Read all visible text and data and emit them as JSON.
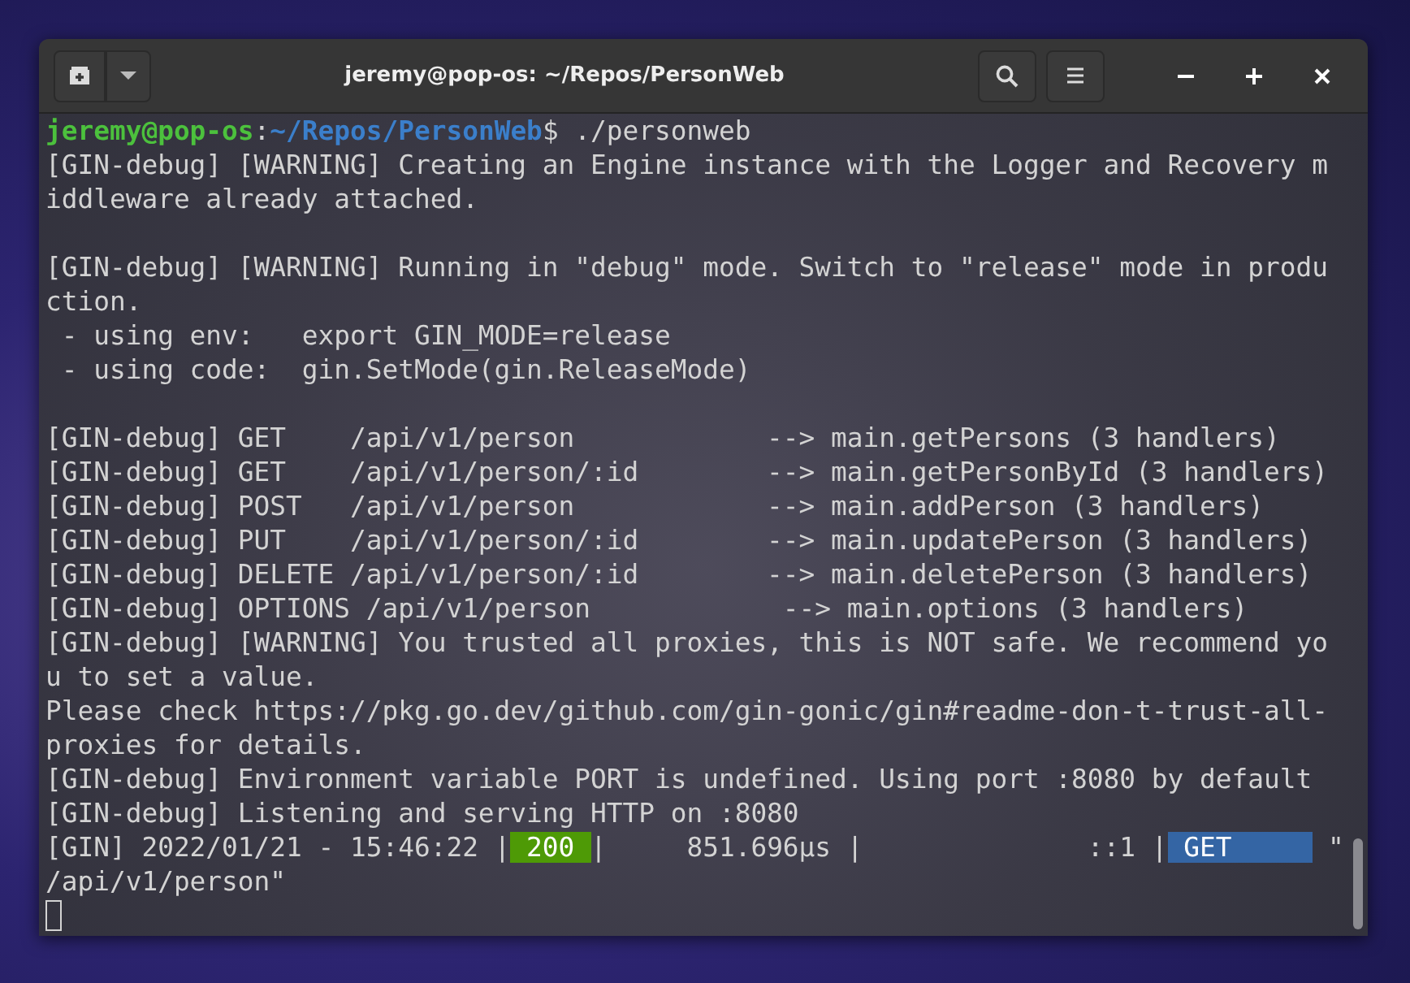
{
  "window": {
    "title": "jeremy@pop-os: ~/Repos/PersonWeb"
  },
  "terminal": {
    "lines": [
      {
        "segments": [
          {
            "kind": "user",
            "text": "jeremy@pop-os"
          },
          {
            "kind": "plain",
            "text": ":"
          },
          {
            "kind": "path",
            "text": "~/Repos/PersonWeb"
          },
          {
            "kind": "plain",
            "text": "$ ./personweb"
          }
        ]
      },
      {
        "segments": [
          {
            "kind": "plain",
            "text": "[GIN-debug] [WARNING] Creating an Engine instance with the Logger and Recovery m"
          }
        ]
      },
      {
        "segments": [
          {
            "kind": "plain",
            "text": "iddleware already attached."
          }
        ]
      },
      {
        "kind": "blank"
      },
      {
        "kind": "output",
        "segments": [
          {
            "kind": "plain",
            "text": "[GIN-debug] [WARNING] Running in \"debug\" mode. Switch to \"release\" mode in produ"
          }
        ]
      },
      {
        "segments": [
          {
            "kind": "plain",
            "text": "ction."
          }
        ]
      },
      {
        "segments": [
          {
            "kind": "plain",
            "text": " - using env:   export GIN_MODE=release"
          }
        ]
      },
      {
        "segments": [
          {
            "kind": "plain",
            "text": " - using code:  gin.SetMode(gin.ReleaseMode)"
          }
        ]
      },
      {
        "kind": "blank"
      },
      {
        "kind": "output",
        "segments": [
          {
            "kind": "plain",
            "text": "[GIN-debug] GET    /api/v1/person            --> main.getPersons (3 handlers)"
          }
        ]
      },
      {
        "segments": [
          {
            "kind": "plain",
            "text": "[GIN-debug] GET    /api/v1/person/:id        --> main.getPersonById (3 handlers)"
          }
        ]
      },
      {
        "segments": [
          {
            "kind": "plain",
            "text": "[GIN-debug] POST   /api/v1/person            --> main.addPerson (3 handlers)"
          }
        ]
      },
      {
        "segments": [
          {
            "kind": "plain",
            "text": "[GIN-debug] PUT    /api/v1/person/:id        --> main.updatePerson (3 handlers)"
          }
        ]
      },
      {
        "segments": [
          {
            "kind": "plain",
            "text": "[GIN-debug] DELETE /api/v1/person/:id        --> main.deletePerson (3 handlers)"
          }
        ]
      },
      {
        "segments": [
          {
            "kind": "plain",
            "text": "[GIN-debug] OPTIONS /api/v1/person            --> main.options (3 handlers)"
          }
        ]
      },
      {
        "segments": [
          {
            "kind": "plain",
            "text": "[GIN-debug] [WARNING] You trusted all proxies, this is NOT safe. We recommend yo"
          }
        ]
      },
      {
        "segments": [
          {
            "kind": "plain",
            "text": "u to set a value."
          }
        ]
      },
      {
        "segments": [
          {
            "kind": "plain",
            "text": "Please check https://pkg.go.dev/github.com/gin-gonic/gin#readme-don-t-trust-all-"
          }
        ]
      },
      {
        "segments": [
          {
            "kind": "plain",
            "text": "proxies for details."
          }
        ]
      },
      {
        "segments": [
          {
            "kind": "plain",
            "text": "[GIN-debug] Environment variable PORT is undefined. Using port :8080 by default"
          }
        ]
      },
      {
        "segments": [
          {
            "kind": "plain",
            "text": "[GIN-debug] Listening and serving HTTP on :8080"
          }
        ]
      },
      {
        "segments": [
          {
            "kind": "plain",
            "text": "[GIN] 2022/01/21 - 15:46:22 |"
          },
          {
            "kind": "status",
            "text": " 200 "
          },
          {
            "kind": "plain",
            "text": "|     851.696µs |              ::1 |"
          },
          {
            "kind": "method",
            "text": " GET     "
          },
          {
            "kind": "plain",
            "text": " \""
          }
        ]
      },
      {
        "segments": [
          {
            "kind": "plain",
            "text": "/api/v1/person\""
          }
        ]
      }
    ]
  }
}
